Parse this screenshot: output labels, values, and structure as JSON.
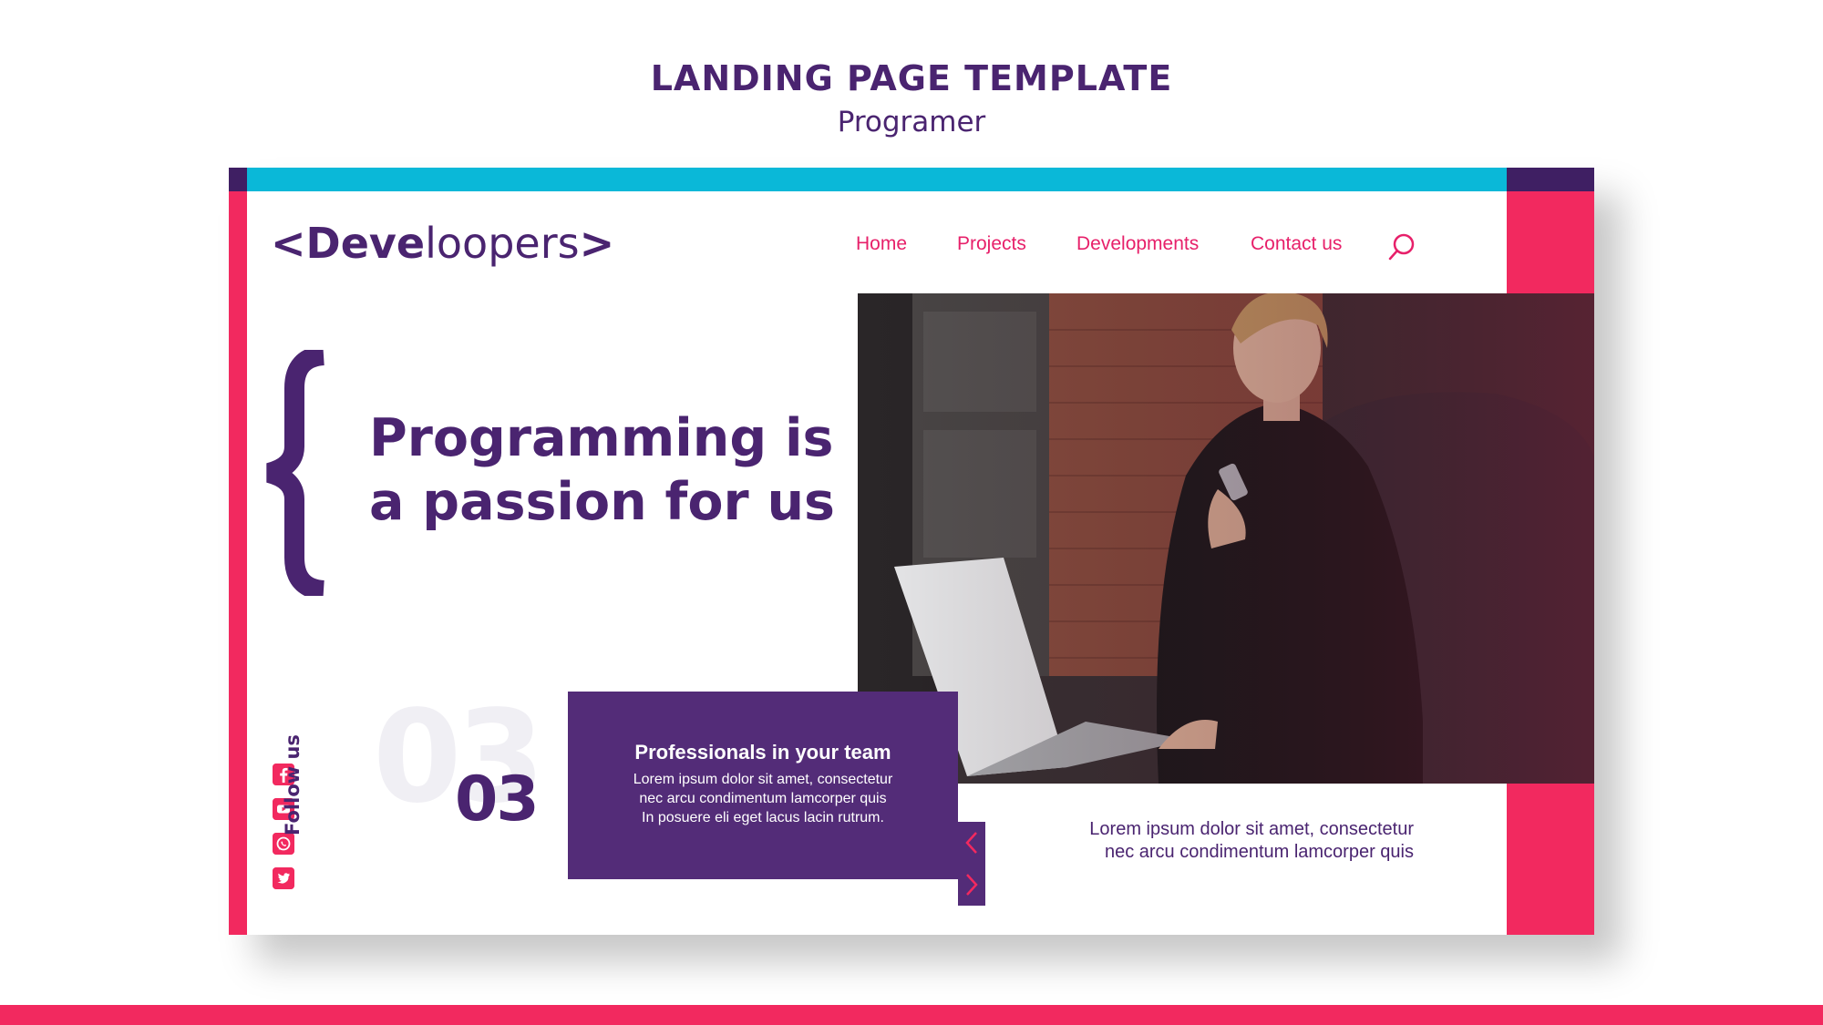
{
  "header": {
    "title": "LANDING PAGE TEMPLATE",
    "subtitle": "Programer"
  },
  "logo": {
    "open_bracket": "<",
    "bold_part": "Deve",
    "light_part": "loopers",
    "close_bracket": ">"
  },
  "nav": {
    "items": [
      {
        "label": "Home"
      },
      {
        "label": "Projects"
      },
      {
        "label": "Developments"
      },
      {
        "label": "Contact us"
      }
    ],
    "search_icon": "search-icon"
  },
  "hero": {
    "line1": "Programming is",
    "line2": "a passion for us"
  },
  "counter": {
    "ghost_number": "03",
    "number": "03"
  },
  "card": {
    "title": "Professionals in your team",
    "body_line1": "Lorem ipsum dolor sit amet, consectetur",
    "body_line2": "nec arcu condimentum lamcorper quis",
    "body_line3": "In posuere eli eget lacus lacin rutrum."
  },
  "side_text": {
    "line1": "Lorem ipsum dolor sit amet, consectetur",
    "line2": "nec arcu condimentum lamcorper quis"
  },
  "social": {
    "label": "Follow us",
    "icons": [
      "facebook-icon",
      "youtube-icon",
      "whatsapp-icon",
      "twitter-icon"
    ]
  },
  "colors": {
    "primary_purple": "#4a2470",
    "card_purple": "#532c78",
    "pink": "#f2295f",
    "cyan": "#0ab8d8",
    "nav_pink": "#e7206a"
  }
}
